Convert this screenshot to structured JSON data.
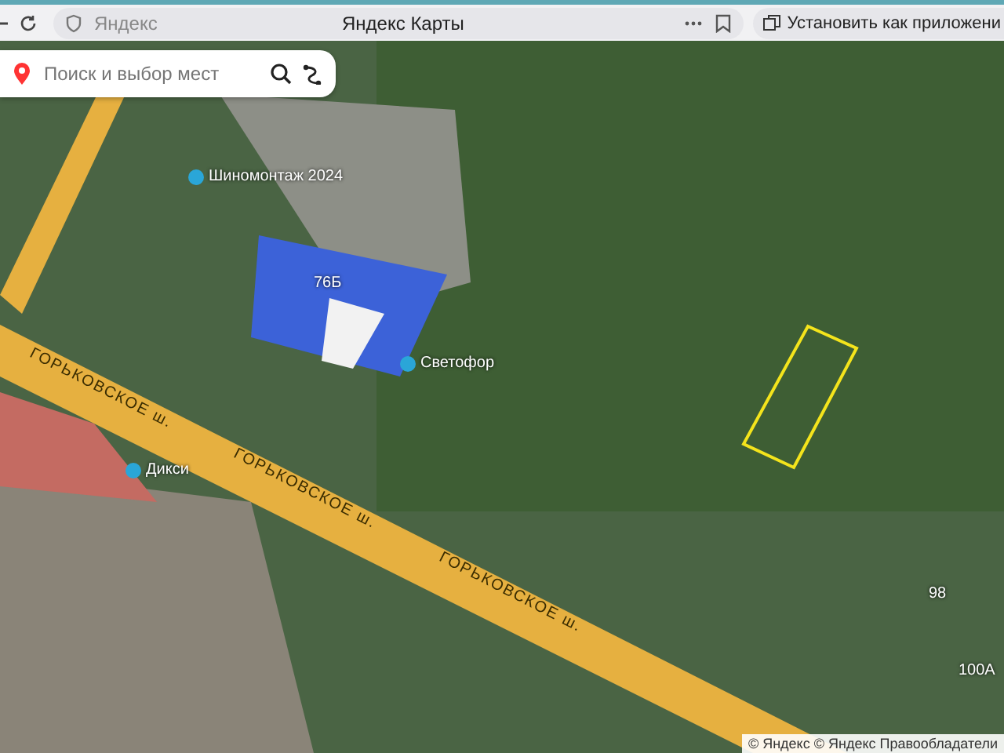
{
  "browser": {
    "address": "Яндекс",
    "title": "Яндекс Карты",
    "install_button": "Установить как приложени"
  },
  "search": {
    "placeholder": "Поиск и выбор мест"
  },
  "map": {
    "labels": [
      {
        "kind": "poi",
        "text": "Шиномонтаж 2024"
      },
      {
        "kind": "poi",
        "text": "Светофор"
      },
      {
        "kind": "poi",
        "text": "Дикси"
      },
      {
        "kind": "house",
        "text": "76Б"
      },
      {
        "kind": "house",
        "text": "98"
      },
      {
        "kind": "house",
        "text": "100А"
      },
      {
        "kind": "street",
        "text": "ГОРЬКОВСКОЕ ш."
      },
      {
        "kind": "street",
        "text": "ГОРЬКОВСКОЕ ш."
      },
      {
        "kind": "street",
        "text": "ГОРЬКОВСКОЕ ш."
      }
    ]
  },
  "attribution": "© Яндекс © Яндекс  Правообладатели"
}
